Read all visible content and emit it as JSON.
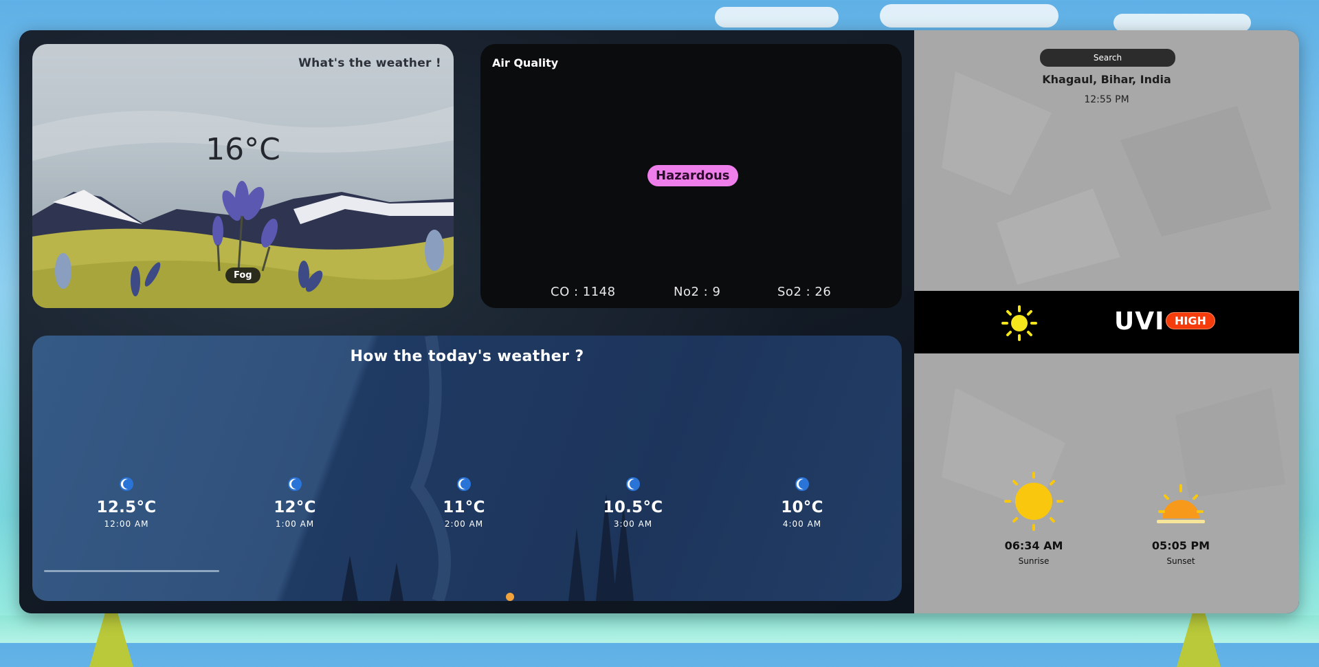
{
  "weather_card": {
    "title": "What's the weather !",
    "temperature": "16°C",
    "condition": "Fog"
  },
  "air_quality": {
    "title": "Air Quality",
    "status": "Hazardous",
    "status_color": "#ee7ee9",
    "stats": [
      {
        "label": "CO : 1148"
      },
      {
        "label": "No2 : 9"
      },
      {
        "label": "So2 : 26"
      }
    ]
  },
  "today": {
    "title": "How the today's weather ?",
    "hours": [
      {
        "temp": "12.5°C",
        "time": "12:00 AM",
        "icon": "moon-icon"
      },
      {
        "temp": "12°C",
        "time": "1:00 AM",
        "icon": "moon-icon"
      },
      {
        "temp": "11°C",
        "time": "2:00 AM",
        "icon": "moon-icon"
      },
      {
        "temp": "10.5°C",
        "time": "3:00 AM",
        "icon": "moon-icon"
      },
      {
        "temp": "10°C",
        "time": "4:00 AM",
        "icon": "moon-icon"
      }
    ]
  },
  "sidebar": {
    "search_placeholder": "Search",
    "location": "Khagaul, Bihar, India",
    "local_time": "12:55 PM",
    "uv": {
      "label": "UVI",
      "level": "HIGH",
      "level_color": "#f43c0c",
      "icon": "sun-icon"
    },
    "sunrise": {
      "time": "06:34 AM",
      "label": "Sunrise",
      "icon": "sunrise-icon"
    },
    "sunset": {
      "time": "05:05 PM",
      "label": "Sunset",
      "icon": "sunset-icon"
    }
  }
}
